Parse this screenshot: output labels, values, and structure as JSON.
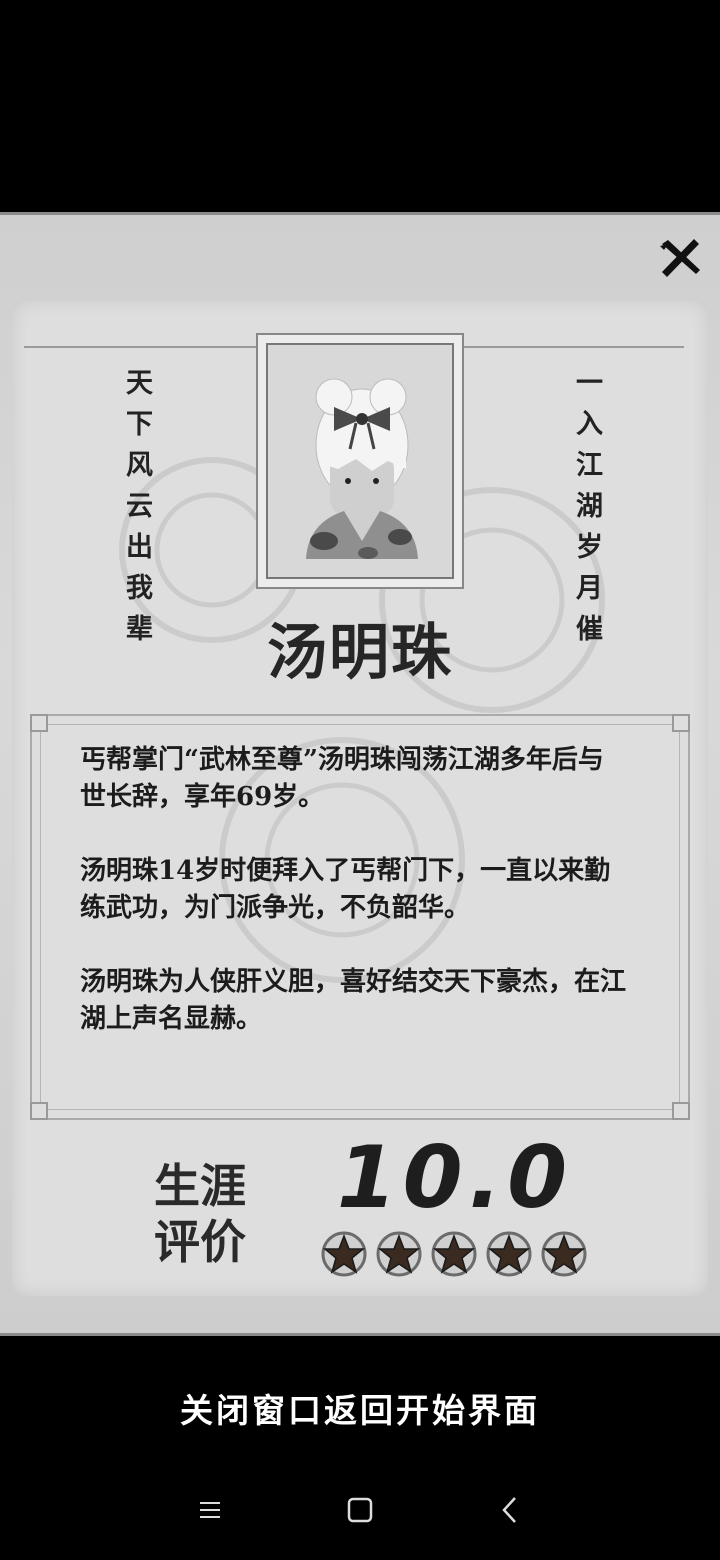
{
  "card": {
    "name": "汤明珠",
    "left_verse": "天下风云出我辈",
    "right_verse": "一入江湖岁月催",
    "bio": [
      "丐帮掌门“武林至尊”汤明珠闯荡江湖多年后与世长辞，享年69岁。",
      "汤明珠14岁时便拜入了丐帮门下，一直以来勤练武功，为门派争光，不负韶华。",
      "汤明珠为人侠肝义胆，喜好结交天下豪杰，在江湖上声名显赫。"
    ],
    "career_label_1": "生涯",
    "career_label_2": "评价",
    "score": "10.0",
    "stars": 5
  },
  "actions": {
    "close_icon": "close-x-brush-icon",
    "return_label": "关闭窗口返回开始界面"
  },
  "navbar": {
    "menu_icon": "menu-icon",
    "home_icon": "home-square-icon",
    "back_icon": "back-chevron-icon"
  },
  "colors": {
    "panel_bg": "#d9d9d9",
    "text_dark": "#1c1c1c",
    "star_fill": "#3a2a20",
    "star_ring": "#6b6b6b"
  }
}
